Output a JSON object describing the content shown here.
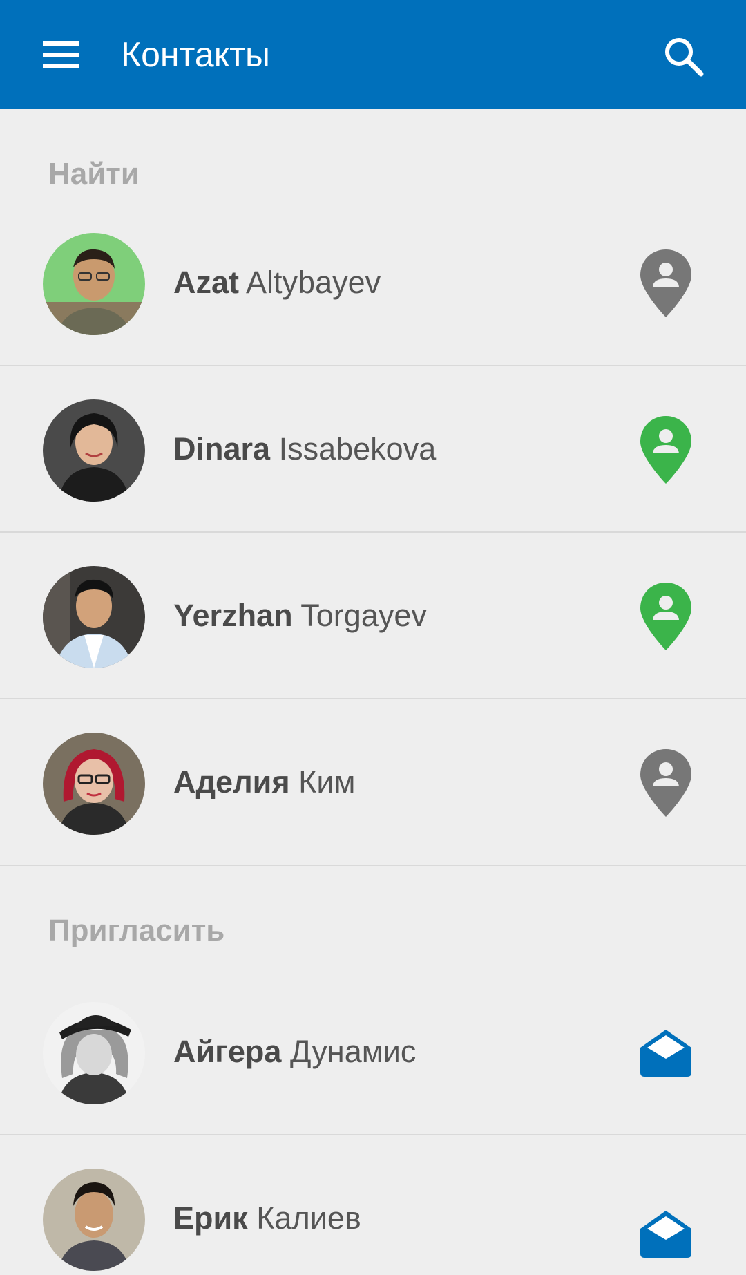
{
  "appbar": {
    "title": "Контакты",
    "menu_icon": "hamburger-menu-icon",
    "search_icon": "search-icon",
    "color": "#0070bb"
  },
  "sections": {
    "find_label": "Найти",
    "invite_label": "Пригласить"
  },
  "find_contacts": [
    {
      "first": "Azat",
      "last": "Altybayev",
      "icon": "location-person-icon",
      "status_color": "#777777"
    },
    {
      "first": "Dinara",
      "last": "Issabekova",
      "icon": "location-person-icon",
      "status_color": "#3bb44a"
    },
    {
      "first": "Yerzhan",
      "last": "Torgayev",
      "icon": "location-person-icon",
      "status_color": "#3bb44a"
    },
    {
      "first": "Аделия",
      "last": "Ким",
      "icon": "location-person-icon",
      "status_color": "#777777"
    }
  ],
  "invite_contacts": [
    {
      "first": "Айгера",
      "last": "Дунамис",
      "icon": "open-envelope-icon",
      "status_color": "#0070bb"
    },
    {
      "first": "Ерик",
      "last": "Калиев",
      "icon": "open-envelope-icon",
      "status_color": "#0070bb"
    }
  ],
  "colors": {
    "background": "#eeeeee",
    "divider": "#d9d9d9",
    "section_label": "#a8a8a8",
    "online_green": "#3bb44a",
    "offline_gray": "#777777"
  }
}
